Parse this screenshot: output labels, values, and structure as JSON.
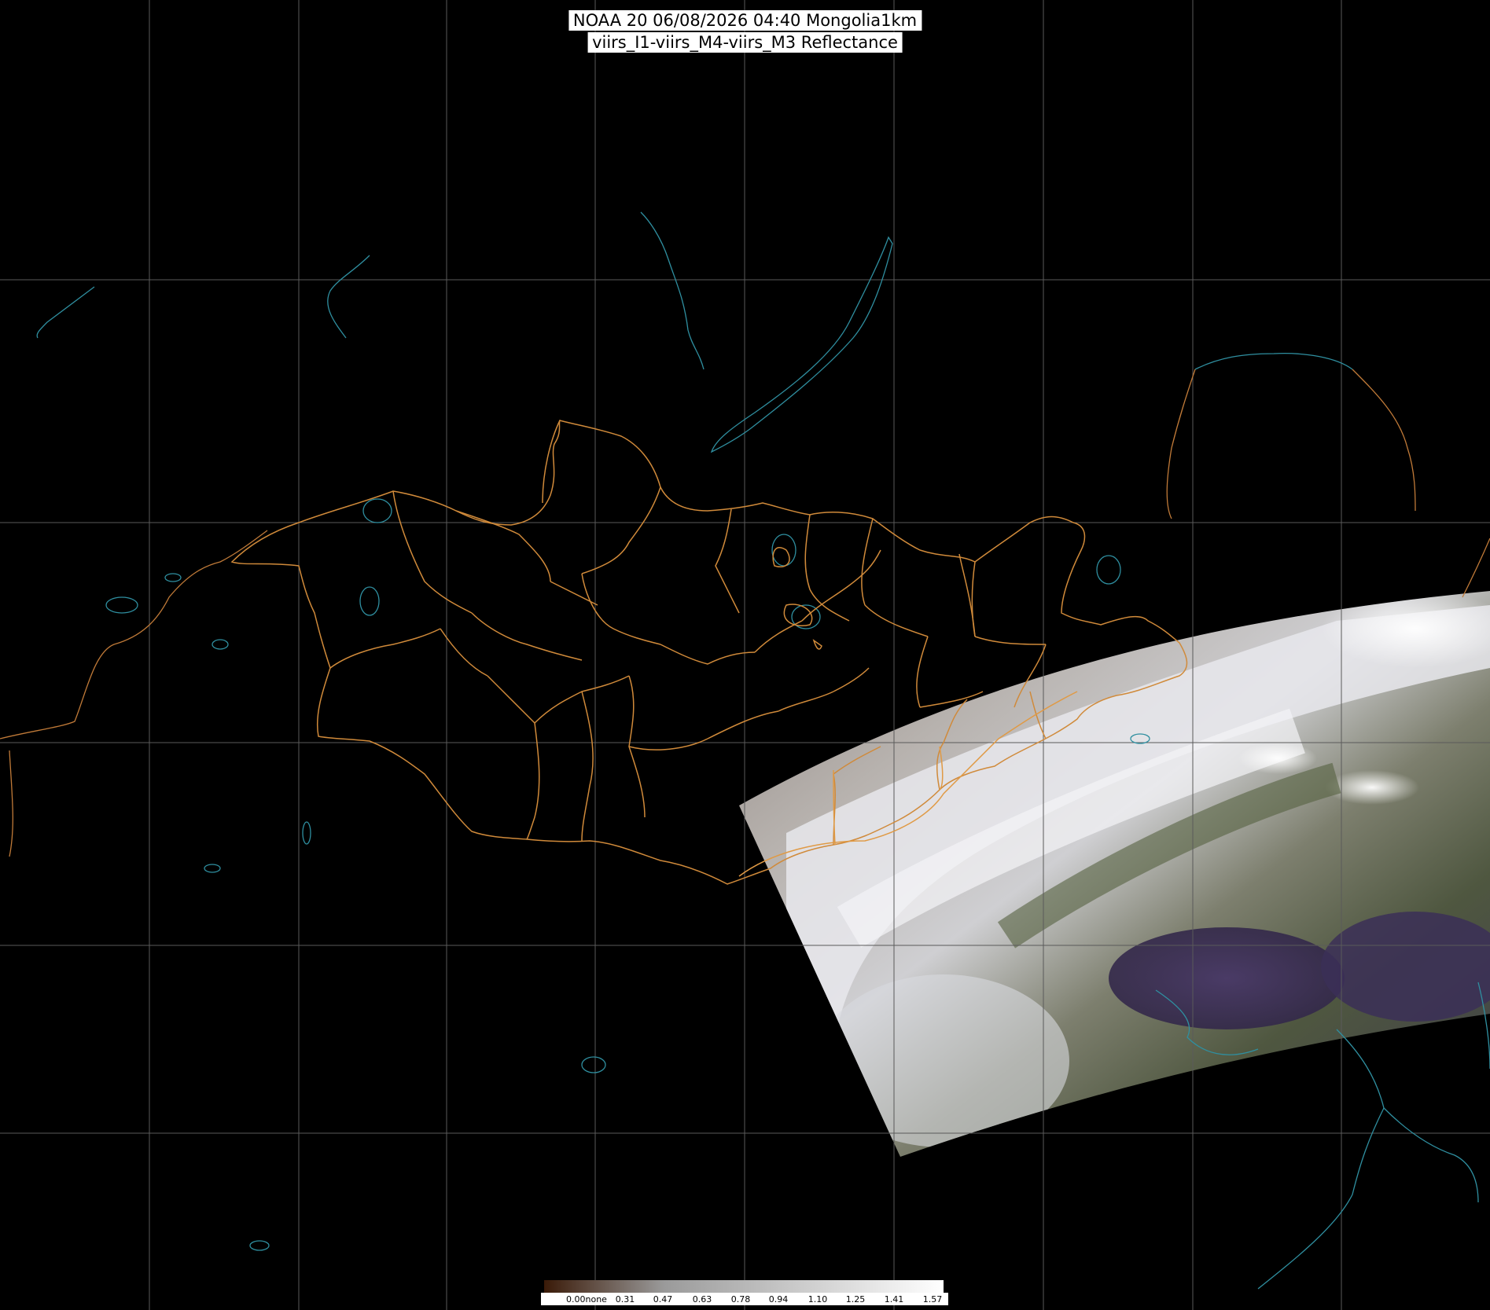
{
  "title": {
    "line1": "NOAA 20 06/08/2026 04:40 Mongolia1km",
    "line2": "viirs_I1-viirs_M4-viirs_M3 Reflectance"
  },
  "colorbar": {
    "labels": [
      "0.00none",
      "0.31",
      "0.47",
      "0.63",
      "0.78",
      "0.94",
      "1.10",
      "1.25",
      "1.41",
      "1.57"
    ],
    "colors": [
      "#3a1a08",
      "#ffffff"
    ]
  },
  "map": {
    "background_color": "#000000",
    "graticule_color": "#5a5a5a",
    "coastline_color": "#2f8fa0",
    "border_color": "#d08a3a",
    "layers": [
      "graticule",
      "coastlines",
      "lakes",
      "country-borders",
      "province-borders",
      "satellite-swath"
    ]
  }
}
